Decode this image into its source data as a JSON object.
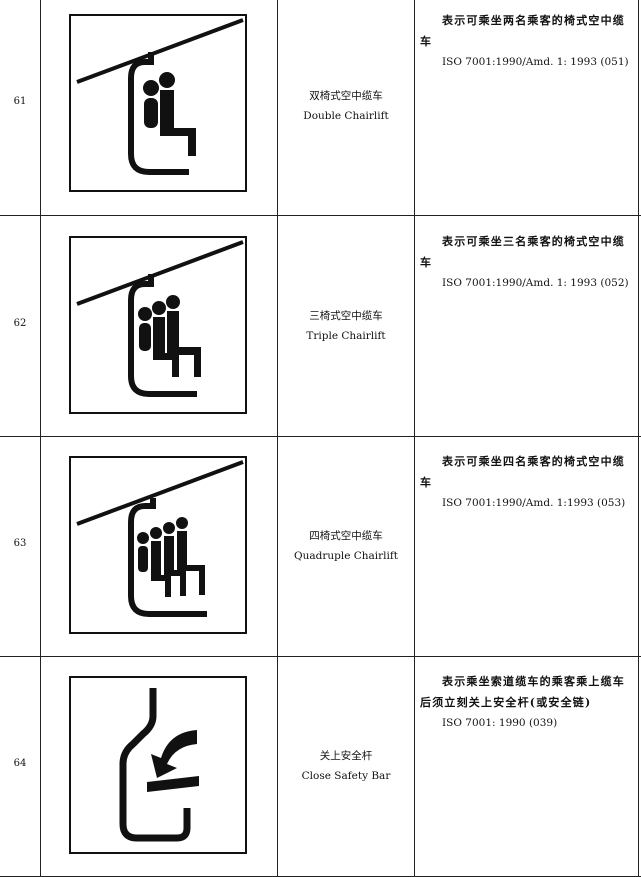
{
  "rows": [
    {
      "num": "61",
      "icon": "double-chairlift-icon",
      "name_zh": "双椅式空中缆车",
      "name_en": "Double Chairlift",
      "desc_zh": "表示可乘坐两名乘客的椅式空中缆车",
      "ref": "ISO 7001:1990/Amd. 1: 1993 (051)"
    },
    {
      "num": "62",
      "icon": "triple-chairlift-icon",
      "name_zh": "三椅式空中缆车",
      "name_en": "Triple Chairlift",
      "desc_zh": "表示可乘坐三名乘客的椅式空中缆车",
      "ref": "ISO 7001:1990/Amd. 1: 1993 (052)"
    },
    {
      "num": "63",
      "icon": "quadruple-chairlift-icon",
      "name_zh": "四椅式空中缆车",
      "name_en": "Quadruple Chairlift",
      "desc_zh": "表示可乘坐四名乘客的椅式空中缆车",
      "ref": "ISO 7001:1990/Amd. 1:1993 (053)"
    },
    {
      "num": "64",
      "icon": "close-safety-bar-icon",
      "name_zh": "关上安全杆",
      "name_en": "Close Safety Bar",
      "desc_zh": "表示乘坐索道缆车的乘客乘上缆车后须立刻关上安全杆(或安全链)",
      "ref": "ISO 7001: 1990 (039)"
    }
  ]
}
